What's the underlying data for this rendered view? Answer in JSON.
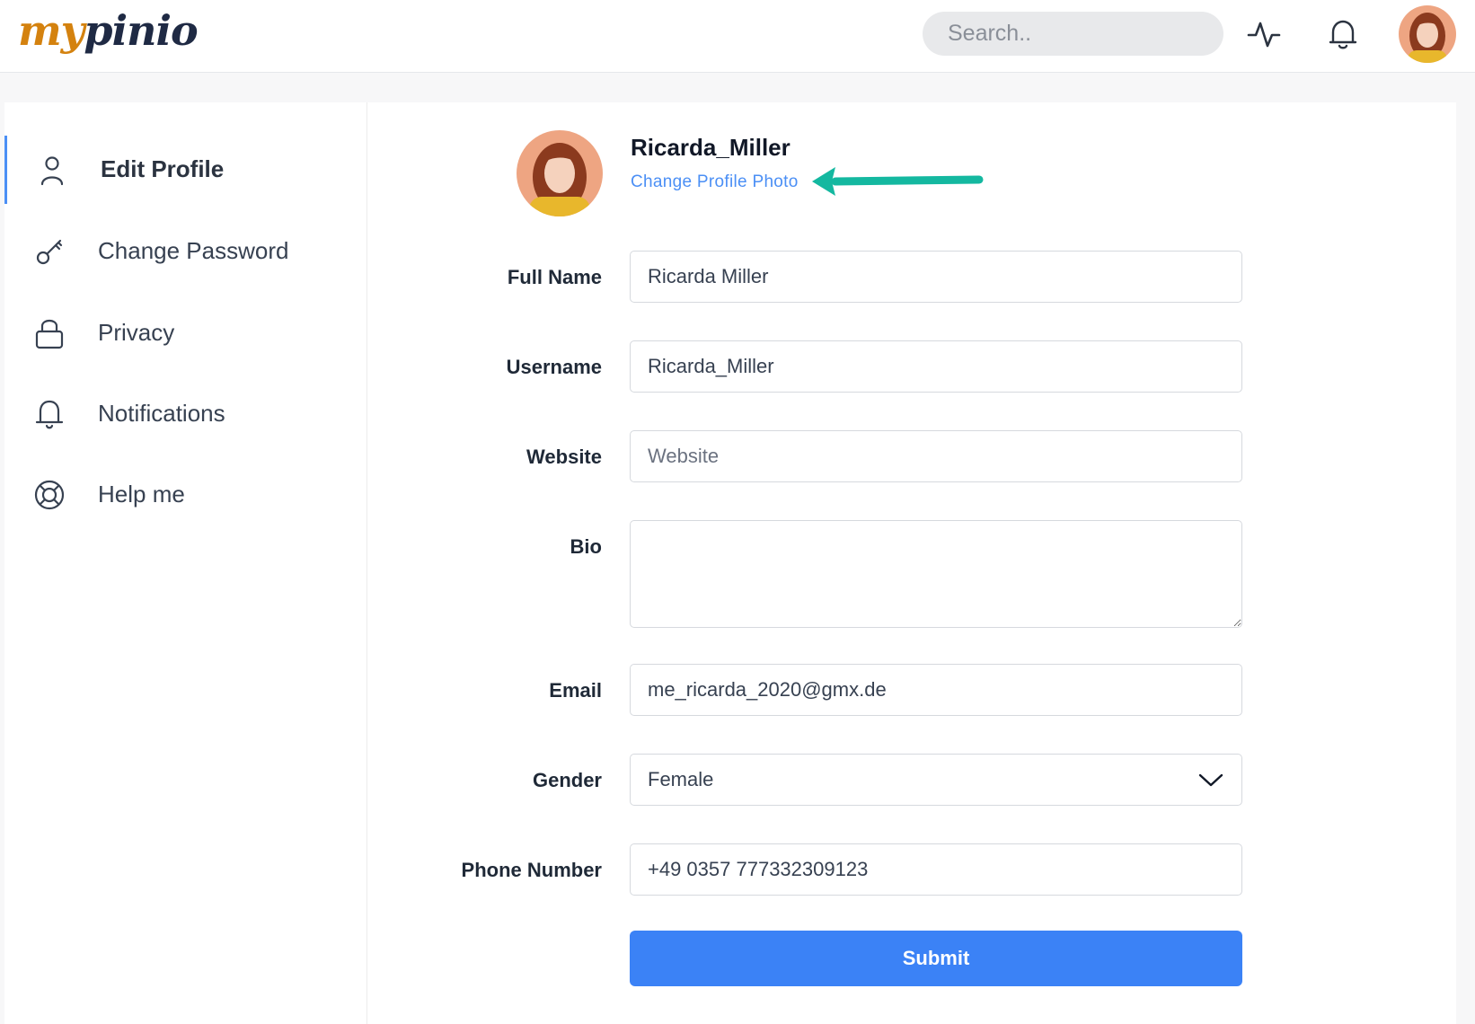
{
  "app": {
    "logo_part1": "my",
    "logo_part2": "pinio"
  },
  "header": {
    "search_placeholder": "Search..",
    "icons": [
      "activity-icon",
      "bell-icon",
      "avatar"
    ]
  },
  "sidebar": {
    "items": [
      {
        "label": "Edit Profile",
        "icon": "user-icon",
        "active": true
      },
      {
        "label": "Change Password",
        "icon": "key-icon",
        "active": false
      },
      {
        "label": "Privacy",
        "icon": "lock-icon",
        "active": false
      },
      {
        "label": "Notifications",
        "icon": "bell-icon",
        "active": false
      },
      {
        "label": "Help me",
        "icon": "lifebuoy-icon",
        "active": false
      }
    ]
  },
  "profile": {
    "username": "Ricarda_Miller",
    "change_photo_label": "Change Profile Photo"
  },
  "form": {
    "full_name": {
      "label": "Full Name",
      "value": "Ricarda Miller"
    },
    "username": {
      "label": "Username",
      "value": "Ricarda_Miller"
    },
    "website": {
      "label": "Website",
      "value": "",
      "placeholder": "Website"
    },
    "bio": {
      "label": "Bio",
      "value": ""
    },
    "email": {
      "label": "Email",
      "value": "me_ricarda_2020@gmx.de"
    },
    "gender": {
      "label": "Gender",
      "value": "Female"
    },
    "phone": {
      "label": "Phone Number",
      "value": "+49 0357 777332309123"
    },
    "submit_label": "Submit"
  },
  "colors": {
    "accent": "#3b82f6",
    "link": "#4b8ff5",
    "annotation_arrow": "#14b8a0",
    "logo_orange": "#d4820f",
    "logo_navy": "#1f2a44"
  }
}
